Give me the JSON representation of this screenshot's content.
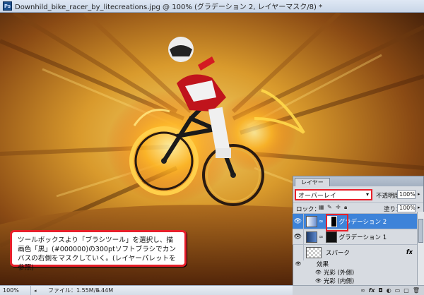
{
  "window": {
    "title": "Downhild_bike_racer_by_litecreations.jpg @ 100% (グラデーション 2, レイヤーマスク/8) *",
    "app_icon": "photoshop-icon"
  },
  "annotation": {
    "text": "ツールボックスより「ブラシツール」を選択し、描画色「黒」(#000000)の300ptソフトブラシでカンバスの右側をマスクしていく。(レイヤーパレットを参照)"
  },
  "layers_panel": {
    "tab": "レイヤー",
    "blend_mode": "オーバーレイ",
    "opacity_label": "不透明度：",
    "opacity_value": "100%",
    "lock_label": "ロック：",
    "fill_label": "塗り：",
    "fill_value": "100%",
    "layers": [
      {
        "name": "グラデーション 2",
        "selected": true
      },
      {
        "name": "グラデーション 1",
        "selected": false
      },
      {
        "name": "スパーク",
        "selected": false,
        "fx": "fx"
      }
    ],
    "effects_label": "効果",
    "effects": [
      "光彩 (外側)",
      "光彩 (内側)"
    ]
  },
  "statusbar": {
    "zoom": "100%",
    "file_info": "ファイル：1.55M/8.44M"
  },
  "colors": {
    "accent_red": "#e8202a",
    "selected_row": "#3d83d9"
  }
}
